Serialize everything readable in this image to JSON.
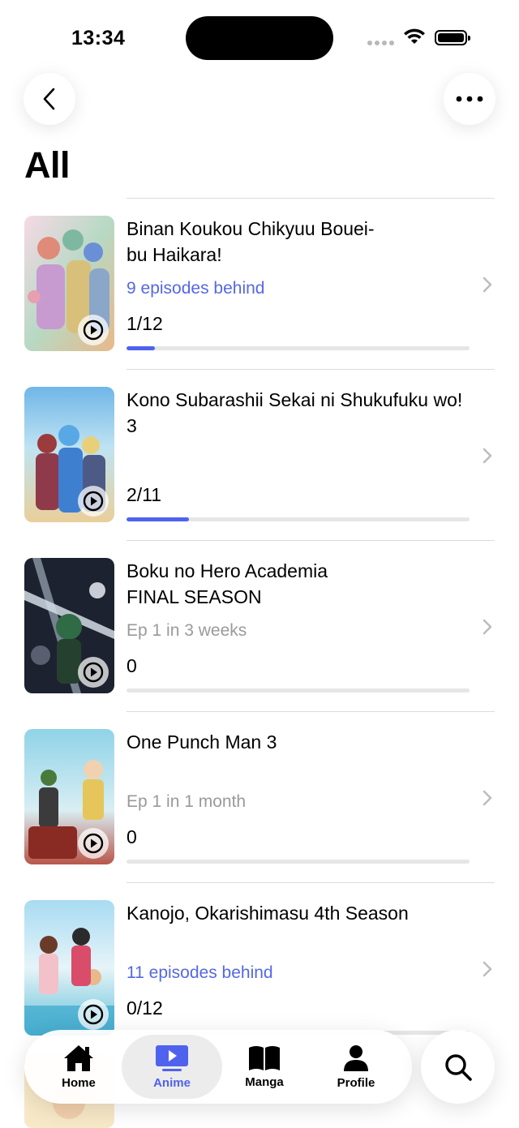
{
  "status_bar": {
    "time": "13:34"
  },
  "header": {
    "title": "All"
  },
  "items": [
    {
      "title": "Binan Koukou Chikyuu Bouei-\nbu Haikara!",
      "status": "9 episodes behind",
      "status_kind": "behind",
      "progress_text": "1/12",
      "progress": 0.083
    },
    {
      "title": "Kono Subarashii Sekai ni Shukufuku wo! 3",
      "status": "",
      "status_kind": "none",
      "progress_text": "2/11",
      "progress": 0.182
    },
    {
      "title": "Boku no Hero Academia\nFINAL SEASON",
      "status": "Ep 1 in 3 weeks",
      "status_kind": "upcoming",
      "progress_text": "0",
      "progress": 0
    },
    {
      "title": "One Punch Man 3",
      "status": "Ep 1 in 1 month",
      "status_kind": "upcoming",
      "progress_text": "0",
      "progress": 0
    },
    {
      "title": "Kanojo, Okarishimasu 4th Season",
      "status": "11 episodes behind",
      "status_kind": "behind",
      "progress_text": "0/12",
      "progress": 0
    }
  ],
  "tab_bar": {
    "tabs": [
      {
        "label": "Home",
        "icon": "house-icon"
      },
      {
        "label": "Anime",
        "icon": "tv-play-icon"
      },
      {
        "label": "Manga",
        "icon": "open-book-icon"
      },
      {
        "label": "Profile",
        "icon": "person-icon"
      }
    ],
    "active": "Anime"
  },
  "colors": {
    "accent": "#4f62ee",
    "behind_text": "#5468e6",
    "upcoming_text": "#9a9a9a"
  }
}
